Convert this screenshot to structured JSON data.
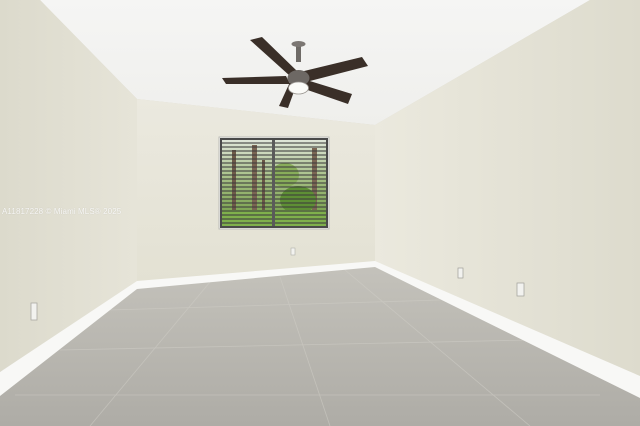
{
  "photo": {
    "subject": "empty-room",
    "watermark": "A11817228 © Miami MLS® 2025",
    "colors": {
      "ceiling": "#f3f3f1",
      "left_wall": "#e2e0d3",
      "back_wall": "#e8e6d9",
      "right_wall": "#e6e4d6",
      "floor": "#b9b7b0",
      "baseboard": "#f7f7f5",
      "fan": "#3a2f28",
      "window_frame": "#4a4a4a",
      "foliage": "#6f9a44"
    }
  }
}
